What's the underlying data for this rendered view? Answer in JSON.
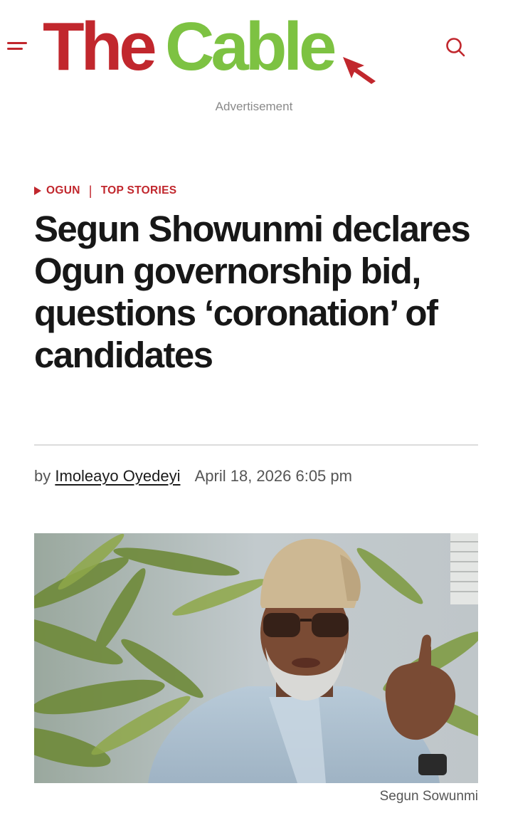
{
  "header": {
    "brand_part1": "The",
    "brand_part2": "Cable",
    "brand_color_red": "#c1272d",
    "brand_color_green": "#7dc242",
    "menu_icon": "hamburger-menu-icon",
    "search_icon": "search-icon"
  },
  "ad": {
    "label": "Advertisement"
  },
  "article": {
    "categories": [
      "OGUN",
      "TOP STORIES"
    ],
    "title": "Segun Showunmi declares Ogun governorship bid, questions ‘coronation’ of candidates",
    "byline_prefix": "by",
    "author": "Imoleayo Oyedeyi",
    "date": "April 18, 2026 6:05 pm",
    "image_caption": "Segun Sowunmi"
  },
  "colors": {
    "accent": "#c1272d",
    "headline": "#171717",
    "meta": "#555555",
    "muted": "#8a8a8a"
  }
}
